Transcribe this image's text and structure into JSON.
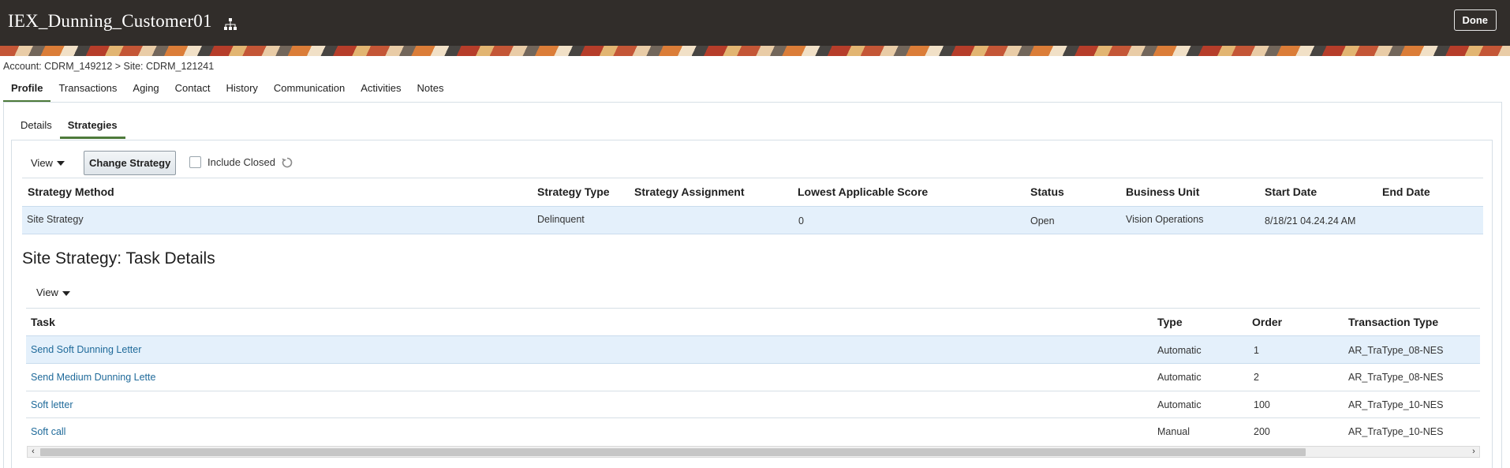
{
  "header": {
    "title": "IEX_Dunning_Customer01",
    "done_label": "Done",
    "icons": {
      "hierarchy": "hierarchy-icon"
    }
  },
  "breadcrumb": "Account: CDRM_149212 > Site: CDRM_121241",
  "main_tabs": [
    {
      "label": "Profile",
      "active": true
    },
    {
      "label": "Transactions"
    },
    {
      "label": "Aging"
    },
    {
      "label": "Contact"
    },
    {
      "label": "History"
    },
    {
      "label": "Communication"
    },
    {
      "label": "Activities"
    },
    {
      "label": "Notes"
    }
  ],
  "sub_tabs": [
    {
      "label": "Details"
    },
    {
      "label": "Strategies",
      "active": true
    }
  ],
  "strategies_toolbar": {
    "view_label": "View",
    "change_strategy_label": "Change Strategy",
    "include_closed_label": "Include Closed",
    "include_closed_checked": false
  },
  "strategies_table": {
    "columns": [
      "Strategy Method",
      "Strategy Type",
      "Strategy Assignment",
      "Lowest Applicable Score",
      "Status",
      "Business Unit",
      "Start Date",
      "End Date"
    ],
    "rows": [
      {
        "method": "Site Strategy",
        "type": "Delinquent",
        "assignment": "",
        "score": "0",
        "status": "Open",
        "business_unit": "Vision Operations",
        "start_date": "8/18/21 04.24.24 AM",
        "end_date": ""
      }
    ]
  },
  "task_section": {
    "title": "Site Strategy: Task Details",
    "view_label": "View",
    "columns": [
      "Task",
      "Type",
      "Order",
      "Transaction Type"
    ],
    "rows": [
      {
        "task": "Send Soft Dunning Letter",
        "type": "Automatic",
        "order": "1",
        "transaction_type": "AR_TraType_08-NES"
      },
      {
        "task": "Send Medium Dunning Lette",
        "type": "Automatic",
        "order": "2",
        "transaction_type": "AR_TraType_08-NES"
      },
      {
        "task": "Soft letter",
        "type": "Automatic",
        "order": "100",
        "transaction_type": "AR_TraType_10-NES"
      },
      {
        "task": "Soft call",
        "type": "Manual",
        "order": "200",
        "transaction_type": "AR_TraType_10-NES"
      }
    ]
  },
  "colors": {
    "header_bg": "#312d2a",
    "active_tab_underline": "#4d7a3a",
    "link": "#1f6a9a",
    "selected_row": "#e4f0fb"
  }
}
